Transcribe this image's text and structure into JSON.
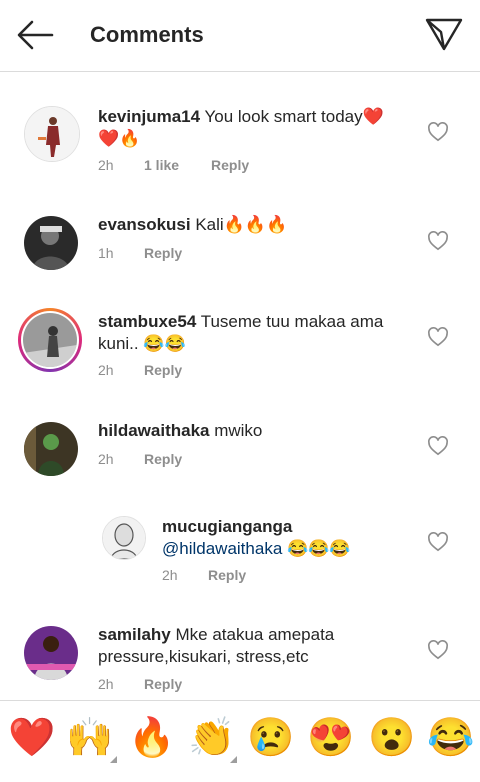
{
  "header": {
    "title": "Comments",
    "back_icon": "arrow-left-icon",
    "send_icon": "send-icon"
  },
  "comments": [
    {
      "username": "kevinjuma14",
      "text": "You look smart today",
      "emojis": "❤️❤️🔥",
      "time": "2h",
      "likes": "1 like",
      "reply": "Reply"
    },
    {
      "username": "evansokusi",
      "text": "Kali",
      "emojis": "🔥🔥🔥",
      "time": "1h",
      "reply": "Reply"
    },
    {
      "username": "stambuxe54",
      "text": "Tuseme tuu makaa ama kuni..",
      "emojis": "😂😂",
      "time": "2h",
      "reply": "Reply"
    },
    {
      "username": "hildawaithaka",
      "text": "mwiko",
      "time": "2h",
      "reply": "Reply"
    },
    {
      "username": "mucugianganga",
      "mention": "@hildawaithaka",
      "emojis": "😂😂😂",
      "time": "2h",
      "reply": "Reply"
    },
    {
      "username": "samilahy",
      "text": "Mke atakua amepata pressure,kisukari, stress,etc",
      "time": "2h",
      "reply": "Reply"
    }
  ],
  "quick_emojis": [
    "❤️",
    "🙌",
    "🔥",
    "👏",
    "😢",
    "😍",
    "😮",
    "😂"
  ],
  "colors": {
    "text": "#262626",
    "meta": "#8e8e8e",
    "mention": "#003569",
    "story_ring": "#dd2a7b"
  }
}
